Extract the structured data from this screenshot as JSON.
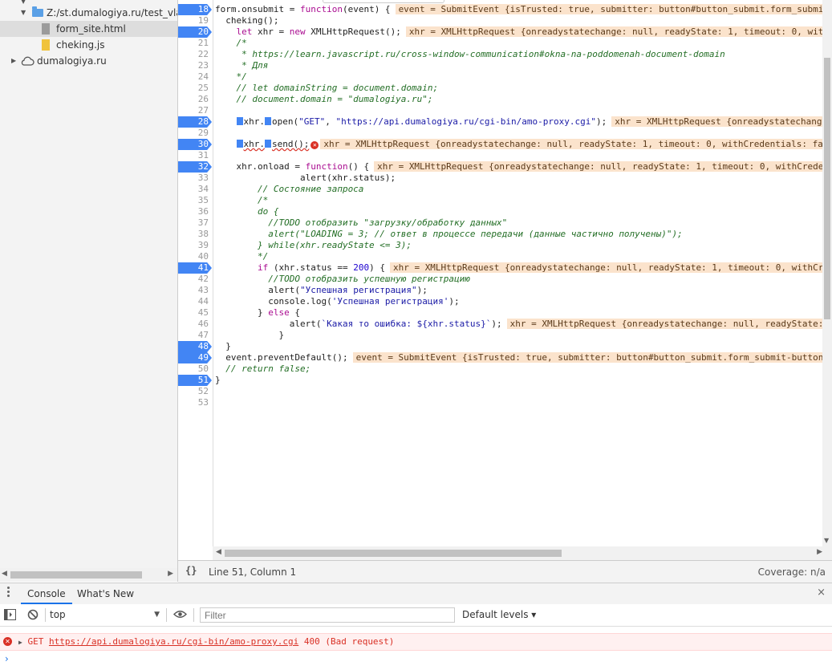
{
  "sidebar": {
    "items": [
      {
        "label": "Z:/st.dumalogiya.ru/test_vlad/a",
        "type": "folder",
        "expanded": true
      },
      {
        "label": "form_site.html",
        "type": "file-html",
        "selected": true
      },
      {
        "label": "cheking.js",
        "type": "file-js"
      },
      {
        "label": "dumalogiya.ru",
        "type": "cloud",
        "expanded": false
      }
    ]
  },
  "editor": {
    "lines": [
      {
        "n": "18",
        "bp": true
      },
      {
        "n": "19"
      },
      {
        "n": "20",
        "bp": true
      },
      {
        "n": "21"
      },
      {
        "n": "22"
      },
      {
        "n": "23"
      },
      {
        "n": "24"
      },
      {
        "n": "25"
      },
      {
        "n": "26"
      },
      {
        "n": "27"
      },
      {
        "n": "28",
        "bp": true
      },
      {
        "n": "29"
      },
      {
        "n": "30",
        "bp": true
      },
      {
        "n": "31"
      },
      {
        "n": "32",
        "bp": true
      },
      {
        "n": "33"
      },
      {
        "n": "34"
      },
      {
        "n": "35"
      },
      {
        "n": "36"
      },
      {
        "n": "37"
      },
      {
        "n": "38"
      },
      {
        "n": "39"
      },
      {
        "n": "40"
      },
      {
        "n": "41",
        "bp": true
      },
      {
        "n": "42"
      },
      {
        "n": "43"
      },
      {
        "n": "44"
      },
      {
        "n": "45"
      },
      {
        "n": "46"
      },
      {
        "n": "47"
      },
      {
        "n": "48",
        "bp": true
      },
      {
        "n": "49",
        "bp": true
      },
      {
        "n": "50"
      },
      {
        "n": "51",
        "bp": true
      },
      {
        "n": "52"
      },
      {
        "n": "53"
      }
    ],
    "code": {
      "l18a": "form.onsubmit = ",
      "l18b": "function",
      "l18c": "(event) {",
      "l18i": "event = SubmitEvent {isTrusted: true, submitter: button#button_submit.form_submi",
      "l19": "  cheking();",
      "l20a": "    ",
      "l20b": "let",
      "l20c": " xhr = ",
      "l20d": "new",
      "l20e": " XMLHttpRequest();",
      "l20i": "xhr = XMLHttpRequest {onreadystatechange: null, readyState: 1, timeout: 0, wit",
      "l21": "    /*",
      "l22": "     * https://learn.javascript.ru/cross-window-communication#okna-na-poddomenah-document-domain",
      "l23": "     * Для",
      "l24": "    */",
      "l25": "    // let domainString = document.domain;",
      "l26": "    // document.domain = \"dumalogiya.ru\";",
      "l28a": "xhr.",
      "l28b": "open(",
      "l28c": "\"GET\"",
      "l28d": ", ",
      "l28e": "\"https://api.dumalogiya.ru/cgi-bin/amo-proxy.cgi\"",
      "l28f": ");",
      "l28i": "xhr = XMLHttpRequest {onreadystatechang",
      "l30a": "xhr.",
      "l30b": "send();",
      "l30i": "xhr = XMLHttpRequest {onreadystatechange: null, readyState: 1, timeout: 0, withCredentials: fal",
      "l32a": "    xhr.onload = ",
      "l32b": "function",
      "l32c": "() {",
      "l32i": "xhr = XMLHttpRequest {onreadystatechange: null, readyState: 1, timeout: 0, withCrede",
      "l33": "                alert(xhr.status);",
      "l34": "        // Состояние запроса",
      "l35": "        /*",
      "l36a": "        ",
      "l36b": "do",
      "l36c": " {",
      "l37": "          //TODO отобразить \"загрузку/обработку данных\"",
      "l38": "          alert(\"LOADING = 3; // ответ в процессе передачи (данные частично получены)\");",
      "l39": "        } while(xhr.readyState <= 3);",
      "l40": "        */",
      "l41a": "        ",
      "l41b": "if",
      "l41c": " (xhr.status == ",
      "l41d": "200",
      "l41e": ") {",
      "l41i": "xhr = XMLHttpRequest {onreadystatechange: null, readyState: 1, timeout: 0, withCr",
      "l42": "          //TODO отобразить успешную регистрацию",
      "l43a": "          alert(",
      "l43b": "\"Успешная регистрация\"",
      "l43c": ");",
      "l44a": "          console.log(",
      "l44b": "'Успешная регистрация'",
      "l44c": ");",
      "l45a": "        } ",
      "l45b": "else",
      "l45c": " {",
      "l46a": "              alert(",
      "l46b": "`Какая то ошибка: ${xhr.status}`",
      "l46c": ");",
      "l46i": "xhr = XMLHttpRequest {onreadystatechange: null, readyState:",
      "l47": "            }",
      "l48": "  }",
      "l49a": "  event.preventDefault();",
      "l49i": "event = SubmitEvent {isTrusted: true, submitter: button#button_submit.form_submit-button",
      "l50": "  // return false;",
      "l51": "}"
    }
  },
  "statusbar": {
    "pretty_print": "{}",
    "position": "Line 51, Column 1",
    "coverage": "Coverage: n/a"
  },
  "drawer": {
    "tabs": [
      {
        "label": "Console",
        "active": true
      },
      {
        "label": "What's New"
      }
    ],
    "close": "×"
  },
  "toolbar": {
    "context": "top",
    "filter_placeholder": "Filter",
    "levels": "Default levels ▾"
  },
  "console": {
    "error": {
      "method": "GET",
      "url": "https://api.dumalogiya.ru/cgi-bin/amo-proxy.cgi",
      "status": "400 (Bad request)"
    },
    "prompt": "›"
  },
  "colors": {
    "breakpoint": "#4285f4",
    "error": "#d93025",
    "inline_value_bg": "#fbe3cc",
    "tab_accent": "#1a73e8"
  },
  "icons": [
    "folder-icon",
    "file-icon",
    "cloud-icon",
    "breakpoint-marker",
    "error-icon",
    "pretty-print-icon",
    "drawer-menu-icon",
    "close-icon",
    "sidebar-toggle-icon",
    "clear-console-icon",
    "eye-icon",
    "chevron-right-icon"
  ]
}
